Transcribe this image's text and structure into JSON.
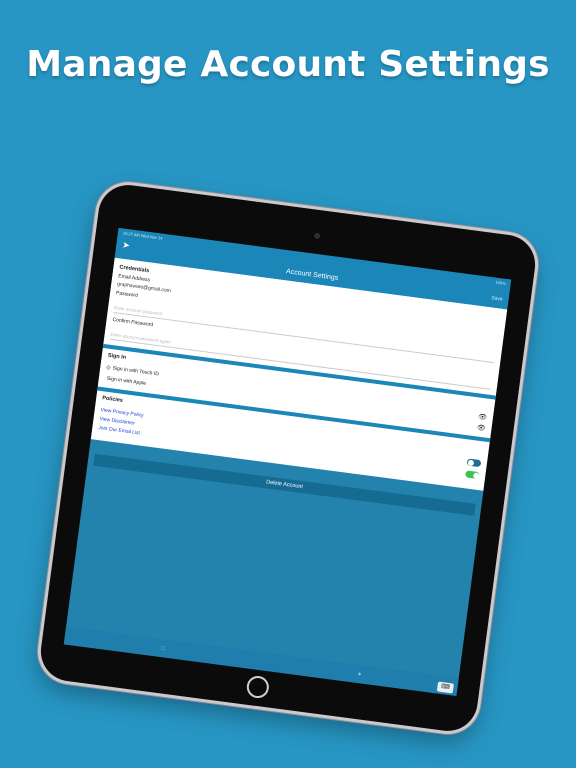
{
  "headline": "Manage Account Settings",
  "statusbar": {
    "time": "10:27 AM",
    "date": "Wed Nov 14",
    "battery": "100%"
  },
  "navbar": {
    "title": "Account Settings",
    "save_label": "Save"
  },
  "credentials": {
    "header": "Credentials",
    "email_label": "Email Address",
    "email_value": "graphsware@gmail.com",
    "password_label": "Password",
    "password_placeholder": "Enter account password",
    "confirm_label": "Confirm Password",
    "confirm_placeholder": "Enter account password again"
  },
  "signin": {
    "header": "Sign In",
    "touch_id_label": "Sign in with Touch ID",
    "apple_label": "Sign in with Apple",
    "touch_id_enabled": false,
    "apple_enabled": true
  },
  "policies": {
    "header": "Policies",
    "links": [
      "View Privacy Policy",
      "View Disclaimer",
      "Join Our Email List"
    ]
  },
  "delete_label": "Delete Account",
  "colors": {
    "background": "#2796c4",
    "bar": "#1b86b8",
    "toggle_on": "#3bc351",
    "toggle_off": "#1f6c93",
    "link": "#1a3fd0"
  }
}
